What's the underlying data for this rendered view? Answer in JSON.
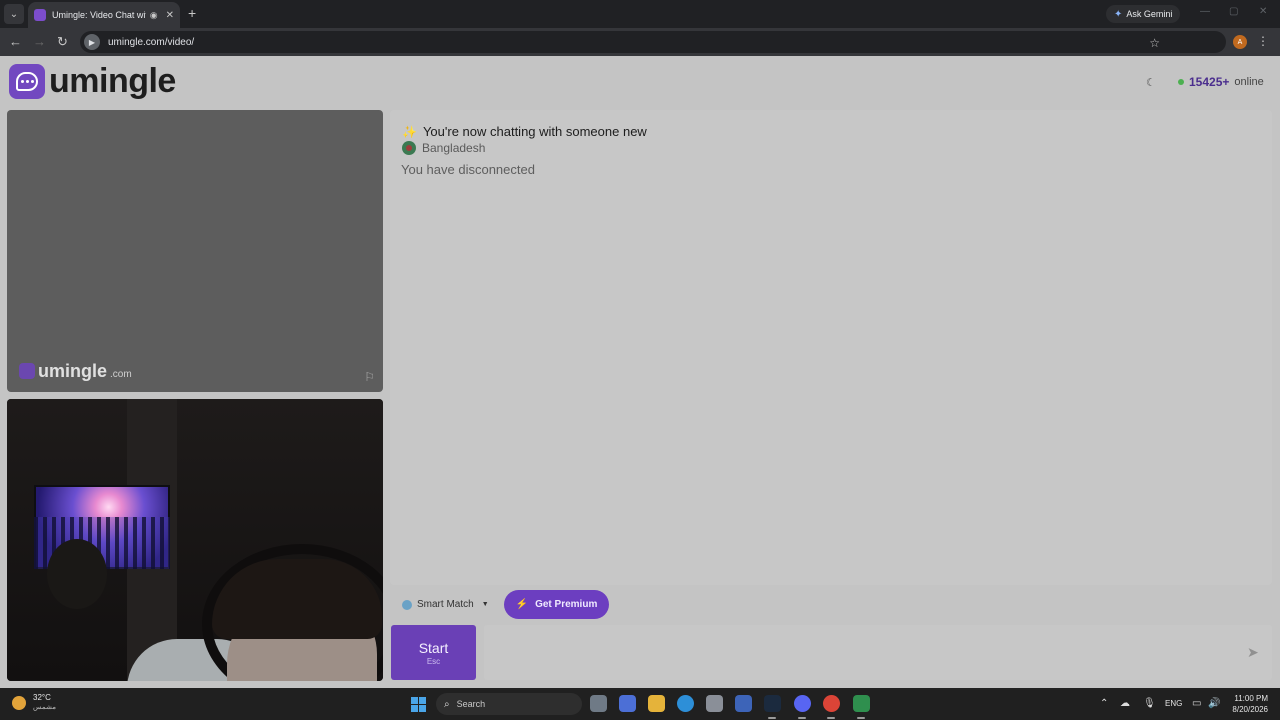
{
  "browser": {
    "tab_title": "Umingle: Video Chat with S",
    "url": "umingle.com/video/",
    "gemini_label": "Ask Gemini",
    "profile_initial": "A"
  },
  "site": {
    "logo_text": "umingle",
    "online_count": "15425+",
    "online_label": "online",
    "watermark_name": "umingle",
    "watermark_domain": ".com"
  },
  "chat": {
    "title": "You're now chatting with someone new",
    "country": "Bangladesh",
    "status": "You have disconnected"
  },
  "controls": {
    "smart_match": "Smart Match",
    "premium": "Get Premium",
    "start": "Start",
    "start_hint": "Esc",
    "message_value": ""
  },
  "taskbar": {
    "weather_temp": "32°C",
    "weather_desc": "مشمس",
    "search_placeholder": "Search",
    "lang": "ENG",
    "time": "11:00 PM",
    "date": "8/20/2026"
  },
  "colors": {
    "brand": "#7248c0",
    "online_dot": "#4cb050",
    "premium_bg": "#6c3ec0"
  }
}
